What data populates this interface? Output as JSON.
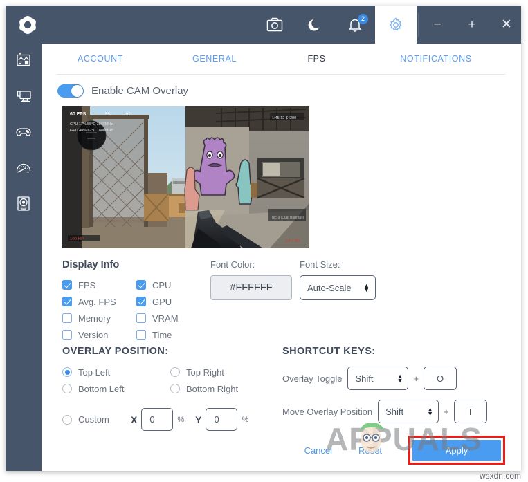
{
  "app": {
    "logo_icon": "cam-logo-icon",
    "titlebar_color": "#47556b",
    "accent_color": "#4a9cf0",
    "highlight_color": "#ee1c17"
  },
  "titlebar": {
    "icons": [
      {
        "name": "screenshot-camera-icon",
        "label": "Screenshot"
      },
      {
        "name": "dark-mode-moon-icon",
        "label": "Dark Mode"
      },
      {
        "name": "notifications-bell-icon",
        "label": "Notifications",
        "badge": "2"
      },
      {
        "name": "settings-gear-icon",
        "label": "Settings",
        "active": true
      }
    ],
    "window_controls": {
      "minimize": "−",
      "maximize": "+",
      "close": "✕"
    }
  },
  "sidebar": {
    "items": [
      {
        "name": "sidebar-item-dashboard",
        "icon": "dashboard-chart-icon"
      },
      {
        "name": "sidebar-item-pc-monitoring",
        "icon": "monitor-pc-icon"
      },
      {
        "name": "sidebar-item-games",
        "icon": "gamepad-icon"
      },
      {
        "name": "sidebar-item-tuning",
        "icon": "speedometer-tuning-icon"
      },
      {
        "name": "sidebar-item-lighting",
        "icon": "webcam-lighting-icon"
      }
    ]
  },
  "tabs": [
    {
      "label": "ACCOUNT",
      "active": false
    },
    {
      "label": "GENERAL",
      "active": false
    },
    {
      "label": "FPS",
      "active": true
    },
    {
      "label": "NOTIFICATIONS",
      "active": false
    }
  ],
  "overlay_toggle": {
    "label": "Enable CAM Overlay",
    "enabled": true
  },
  "preview": {
    "alt": "CS:GO gameplay screenshot with FPS overlay",
    "overlay_fps": "60 FPS"
  },
  "display_info": {
    "title": "Display Info",
    "checkboxes": [
      {
        "label": "FPS",
        "checked": true
      },
      {
        "label": "CPU",
        "checked": true
      },
      {
        "label": "Avg. FPS",
        "checked": true
      },
      {
        "label": "GPU",
        "checked": true
      },
      {
        "label": "Memory",
        "checked": false
      },
      {
        "label": "VRAM",
        "checked": false
      },
      {
        "label": "Version",
        "checked": false
      },
      {
        "label": "Time",
        "checked": false
      }
    ]
  },
  "font_color": {
    "label": "Font Color:",
    "value": "#FFFFFF"
  },
  "font_size": {
    "label": "Font Size:",
    "value": "Auto-Scale",
    "spinner_icon": "spinner-up-down-icon"
  },
  "overlay_position": {
    "title": "OVERLAY POSITION:",
    "options": [
      {
        "label": "Top Left",
        "selected": true
      },
      {
        "label": "Top Right",
        "selected": false
      },
      {
        "label": "Bottom Left",
        "selected": false
      },
      {
        "label": "Bottom Right",
        "selected": false
      }
    ],
    "custom": {
      "label": "Custom",
      "selected": false,
      "x_key": "X",
      "x_value": "0",
      "x_unit": "%",
      "y_key": "Y",
      "y_value": "0",
      "y_unit": "%"
    }
  },
  "shortcut_keys": {
    "title": "SHORTCUT KEYS:",
    "rows": [
      {
        "label": "Overlay Toggle",
        "modifier": "Shift",
        "plus": "+",
        "key": "O"
      },
      {
        "label": "Move Overlay Position",
        "modifier": "Shift",
        "plus": "+",
        "key": "T"
      }
    ]
  },
  "actions": {
    "cancel": "Cancel",
    "reset": "Reset",
    "apply": "Apply"
  },
  "watermarks": {
    "appuals": "APPUALS",
    "site": "wsxdn.com"
  }
}
